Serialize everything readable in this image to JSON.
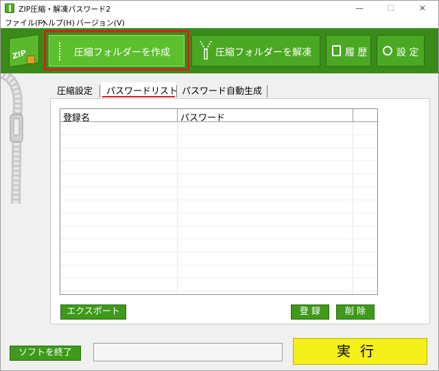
{
  "window": {
    "title": "ZIP圧縮・解凍パスワード2",
    "controls": {
      "minimize": "—",
      "maximize": "☐",
      "close": "✕"
    }
  },
  "menu": [
    {
      "label": "ファイル(F)"
    },
    {
      "label": "ヘルプ(H)"
    },
    {
      "label": "バージョン(V)"
    }
  ],
  "logo": {
    "text": "ZIP"
  },
  "toolbar": {
    "create_label": "圧縮フォルダーを作成",
    "extract_label": "圧縮フォルダーを解凍",
    "history_label": "履 歴",
    "settings_label": "設 定"
  },
  "tabs": [
    {
      "label": "圧縮設定",
      "active": false
    },
    {
      "label": "パスワードリスト",
      "active": true
    },
    {
      "label": "パスワード自動生成",
      "active": false
    }
  ],
  "table": {
    "columns": [
      "登録名",
      "パスワード"
    ],
    "rows": []
  },
  "buttons": {
    "export": "エクスポート",
    "register": "登 録",
    "delete": "削 除",
    "exit": "ソフトを終了",
    "run": "実行"
  },
  "status_text": "",
  "colors": {
    "toolbar_green": "#3a8a1a",
    "button_green": "#3f9a1c",
    "highlight_red": "#d42020",
    "run_yellow": "#f5ef1a"
  },
  "icons": {
    "history": "document-icon",
    "settings": "gear-icon",
    "create": "zipper-icon",
    "extract": "unzip-icon"
  }
}
